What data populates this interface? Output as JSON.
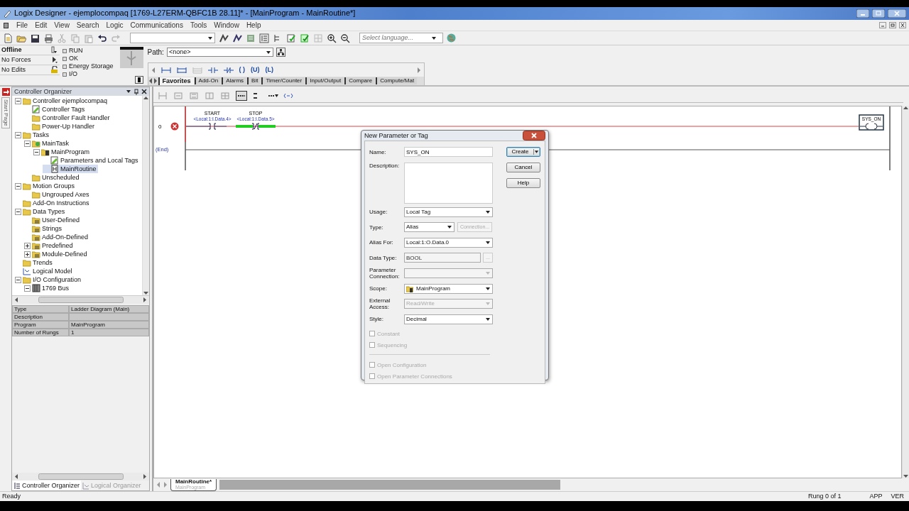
{
  "window": {
    "title": "Logix Designer - ejemplocompaq [1769-L27ERM-QBFC1B 28.11]* - [MainProgram - MainRoutine*]"
  },
  "menu": [
    "File",
    "Edit",
    "View",
    "Search",
    "Logic",
    "Communications",
    "Tools",
    "Window",
    "Help"
  ],
  "toolbar": {
    "language_placeholder": "Select language..."
  },
  "status_panel": {
    "mode": "Offline",
    "forces": "No Forces",
    "edits": "No Edits",
    "indicators": [
      {
        "label": "RUN",
        "on": false
      },
      {
        "label": "OK",
        "on": false
      },
      {
        "label": "Energy Storage",
        "on": false
      },
      {
        "label": "I/O",
        "on": false
      }
    ]
  },
  "path": {
    "label": "Path:",
    "value": "<none>"
  },
  "element_buttons": [
    {
      "kind": "rung",
      "disabled": false
    },
    {
      "kind": "branch",
      "disabled": false
    },
    {
      "kind": "branch_level",
      "disabled": true
    },
    {
      "kind": "xic",
      "disabled": false
    },
    {
      "kind": "xio",
      "disabled": false
    },
    {
      "kind": "coil",
      "label": "( )",
      "disabled": false
    },
    {
      "kind": "coil",
      "label": "(U)",
      "disabled": false
    },
    {
      "kind": "coil",
      "label": "(L)",
      "disabled": false
    }
  ],
  "instruction_tabs": [
    {
      "label": "Favorites",
      "selected": true
    },
    {
      "label": "Add-On",
      "selected": false
    },
    {
      "label": "Alarms",
      "selected": false
    },
    {
      "label": "Bit",
      "selected": false
    },
    {
      "label": "Timer/Counter",
      "selected": false
    },
    {
      "label": "Input/Output",
      "selected": false
    },
    {
      "label": "Compare",
      "selected": false
    },
    {
      "label": "Compute/Mat",
      "selected": false
    }
  ],
  "side_tab": "Start Page",
  "organizer": {
    "title": "Controller Organizer",
    "tree": [
      {
        "label": "Controller ejemplocompaq",
        "kind": "folder",
        "expanded": true,
        "selected": false,
        "children": [
          {
            "label": "Controller Tags",
            "kind": "tags",
            "selected": false
          },
          {
            "label": "Controller Fault Handler",
            "kind": "folder",
            "selected": false
          },
          {
            "label": "Power-Up Handler",
            "kind": "folder",
            "selected": false
          }
        ]
      },
      {
        "label": "Tasks",
        "kind": "folder",
        "expanded": true,
        "selected": false,
        "children": [
          {
            "label": "MainTask",
            "kind": "task",
            "expanded": true,
            "selected": false,
            "children": [
              {
                "label": "MainProgram",
                "kind": "program",
                "expanded": true,
                "selected": false,
                "children": [
                  {
                    "label": "Parameters and Local Tags",
                    "kind": "tags",
                    "selected": false
                  },
                  {
                    "label": "MainRoutine",
                    "kind": "routine",
                    "selected": true
                  }
                ]
              }
            ]
          },
          {
            "label": "Unscheduled",
            "kind": "folder",
            "selected": false
          }
        ]
      },
      {
        "label": "Motion Groups",
        "kind": "folder",
        "expanded": true,
        "selected": false,
        "children": [
          {
            "label": "Ungrouped Axes",
            "kind": "folder",
            "selected": false
          }
        ]
      },
      {
        "label": "Add-On Instructions",
        "kind": "folder",
        "selected": false
      },
      {
        "label": "Data Types",
        "kind": "folder",
        "expanded": true,
        "selected": false,
        "children": [
          {
            "label": "User-Defined",
            "kind": "datatype",
            "selected": false
          },
          {
            "label": "Strings",
            "kind": "datatype",
            "selected": false
          },
          {
            "label": "Add-On-Defined",
            "kind": "datatype",
            "selected": false
          },
          {
            "label": "Predefined",
            "kind": "datatype",
            "expanded": false,
            "selected": false
          },
          {
            "label": "Module-Defined",
            "kind": "datatype",
            "expanded": false,
            "selected": false
          }
        ]
      },
      {
        "label": "Trends",
        "kind": "folder",
        "selected": false
      },
      {
        "label": "Logical Model",
        "kind": "model",
        "selected": false
      },
      {
        "label": "I/O Configuration",
        "kind": "folder",
        "expanded": true,
        "selected": false,
        "children": [
          {
            "label": "1769 Bus",
            "kind": "bus",
            "expanded": true,
            "selected": false
          }
        ]
      }
    ]
  },
  "properties": [
    {
      "name": "Type",
      "value": "Ladder Diagram (Main)"
    },
    {
      "name": "Description"
    },
    {
      "name": "Program",
      "value": "MainProgram"
    },
    {
      "name": "Number of Rungs",
      "value": "1"
    }
  ],
  "organizer_tabs": [
    {
      "label": "Controller Organizer",
      "selected": true
    },
    {
      "label": "Logical Organizer",
      "selected": false
    }
  ],
  "ladder": {
    "rungs": [
      {
        "number": "0",
        "error": true,
        "instructions": [
          {
            "kind": "xic",
            "name": "START",
            "address": "<Local:1:I.Data.4>",
            "energized": false
          },
          {
            "kind": "xio",
            "name": "STOP",
            "address": "<Local:1:I.Data.5>",
            "energized": true
          }
        ],
        "output": {
          "kind": "ote",
          "name": "SYS_ON"
        }
      }
    ],
    "end_label": "(End)"
  },
  "routine_tab": {
    "label": "MainRoutine*",
    "sublabel": "MainProgram"
  },
  "dialog": {
    "title": "New Parameter or Tag",
    "fields": [
      {
        "kind": "text",
        "label": "Name:",
        "value": "SYS_ON"
      },
      {
        "kind": "textarea",
        "label": "Description:"
      },
      {
        "kind": "select",
        "label": "Usage:",
        "value": "Local Tag",
        "disabled": false
      },
      {
        "kind": "select_button",
        "label": "Type:",
        "value": "Alias",
        "disabled": false,
        "button": "Connection...",
        "button_disabled": true
      },
      {
        "kind": "combo",
        "label": "Alias For:",
        "value": "Local:1:O.Data.0"
      },
      {
        "kind": "readonly",
        "label": "Data Type:",
        "value": "BOOL",
        "button": "..."
      },
      {
        "kind": "select",
        "label": "Parameter Connection:",
        "disabled": true
      },
      {
        "kind": "select_icon",
        "label": "Scope:",
        "value": "MainProgram",
        "disabled": false
      },
      {
        "kind": "select",
        "label": "External Access:",
        "value": "Read/Write",
        "disabled": true
      },
      {
        "kind": "select",
        "label": "Style:",
        "value": "Decimal",
        "disabled": false
      }
    ],
    "checks": [
      {
        "label": "Constant",
        "checked": false,
        "disabled": true
      },
      {
        "label": "Sequencing",
        "checked": false,
        "disabled": true
      },
      {
        "label": "Open Configuration",
        "checked": false,
        "disabled": true
      },
      {
        "label": "Open Parameter Connections",
        "checked": false,
        "disabled": true
      }
    ],
    "buttons": [
      {
        "label": "Create",
        "kind": "split",
        "default": true
      },
      {
        "label": "Cancel",
        "kind": "plain",
        "default": false
      },
      {
        "label": "Help",
        "kind": "plain",
        "default": false
      }
    ]
  },
  "status_bar": {
    "message": "Ready",
    "rung": "Rung 0 of 1",
    "mode": "APP",
    "keyboard": "VER"
  }
}
